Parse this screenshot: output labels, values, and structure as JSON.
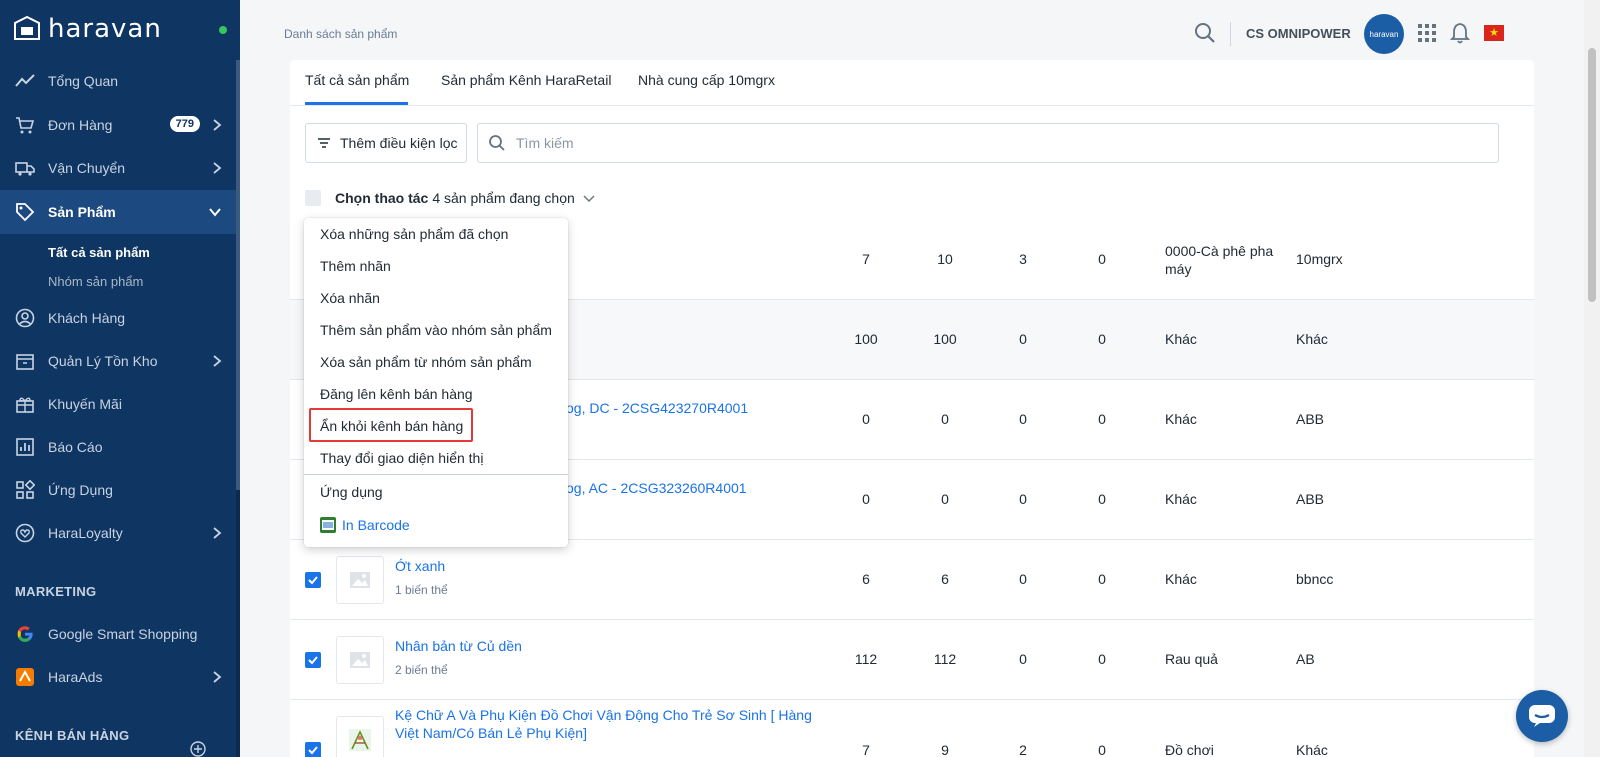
{
  "sidebar": {
    "logo_text": "haravan",
    "nav": [
      {
        "label": "Tổng Quan",
        "icon": "trend-line-icon"
      },
      {
        "label": "Đơn Hàng",
        "icon": "cart-icon",
        "badge": "779"
      },
      {
        "label": "Vận Chuyển",
        "icon": "truck-icon"
      },
      {
        "label": "Sản Phẩm",
        "icon": "tag-icon"
      },
      {
        "label": "Khách Hàng",
        "icon": "user-circle-icon"
      },
      {
        "label": "Quản Lý Tồn Kho",
        "icon": "inventory-icon"
      },
      {
        "label": "Khuyến Mãi",
        "icon": "gift-icon"
      },
      {
        "label": "Báo Cáo",
        "icon": "report-icon"
      },
      {
        "label": "Ứng Dụng",
        "icon": "apps-grid-icon"
      },
      {
        "label": "HaraLoyalty",
        "icon": "heart-icon"
      },
      {
        "label": "Google Smart Shopping",
        "icon": "google-icon"
      },
      {
        "label": "HaraAds",
        "icon": "haraads-icon"
      }
    ],
    "sub_products": [
      "Tất cả sản phẩm",
      "Nhóm sản phẩm"
    ],
    "section_marketing": "MARKETING",
    "section_channels": "KÊNH BÁN HÀNG"
  },
  "topbar": {
    "breadcrumb": "Danh sách sản phẩm",
    "store_name": "CS OMNIPOWER",
    "avatar_text": "haravan",
    "flag": "★"
  },
  "tabs": [
    "Tất cả sản phẩm",
    "Sản phẩm Kênh HaraRetail",
    "Nhà cung cấp 10mgrx"
  ],
  "filter": {
    "button_label": "Thêm điều kiện lọc",
    "search_placeholder": "Tìm kiếm"
  },
  "bulk": {
    "action_label": "Chọn thao tác",
    "selected_text": "4 sản phẩm đang chọn"
  },
  "dropdown": {
    "items": [
      "Xóa những sản phẩm đã chọn",
      "Thêm nhãn",
      "Xóa nhãn",
      "Thêm sản phẩm vào nhóm sản phẩm",
      "Xóa sản phẩm từ nhóm sản phẩm",
      "Đăng lên kênh bán hàng",
      "Ẩn khỏi kênh bán hàng",
      "Thay đổi giao diện hiển thị",
      "Ứng dụng"
    ],
    "barcode": "In Barcode",
    "highlighted_item": "Ẩn khỏi kênh bán hàng"
  },
  "rows": [
    {
      "name": "",
      "variants": "",
      "c1": "7",
      "c2": "10",
      "c3": "3",
      "c4": "0",
      "type": "0000-Cà phê pha máy",
      "vendor": "10mgrx"
    },
    {
      "name": "",
      "variants": "",
      "c1": "100",
      "c2": "100",
      "c3": "0",
      "c4": "0",
      "type": "Khác",
      "vendor": "Khác"
    },
    {
      "name": "og, DC - 2CSG423270R4001",
      "variants": "",
      "c1": "0",
      "c2": "0",
      "c3": "0",
      "c4": "0",
      "type": "Khác",
      "vendor": "ABB"
    },
    {
      "name": "og, AC - 2CSG323260R4001",
      "variants": "",
      "c1": "0",
      "c2": "0",
      "c3": "0",
      "c4": "0",
      "type": "Khác",
      "vendor": "ABB"
    },
    {
      "name": "Ớt xanh",
      "variants": "1 biến thể",
      "c1": "6",
      "c2": "6",
      "c3": "0",
      "c4": "0",
      "type": "Khác",
      "vendor": "bbncc"
    },
    {
      "name": "Nhân bản từ Củ dền",
      "variants": "2 biến thể",
      "c1": "112",
      "c2": "112",
      "c3": "0",
      "c4": "0",
      "type": "Rau quả",
      "vendor": "AB"
    },
    {
      "name": "Kệ Chữ A Và Phụ Kiện Đồ Chơi Vận Động Cho Trẻ Sơ Sinh [ Hàng Việt Nam/Có Bán Lẻ Phụ Kiện]",
      "variants": "",
      "c1": "7",
      "c2": "9",
      "c3": "2",
      "c4": "0",
      "type": "Đồ chơi",
      "vendor": "Khác"
    }
  ],
  "colors": {
    "sidebar": "#0f3562",
    "accent": "#1a73e8",
    "highlight": "#e53935"
  }
}
